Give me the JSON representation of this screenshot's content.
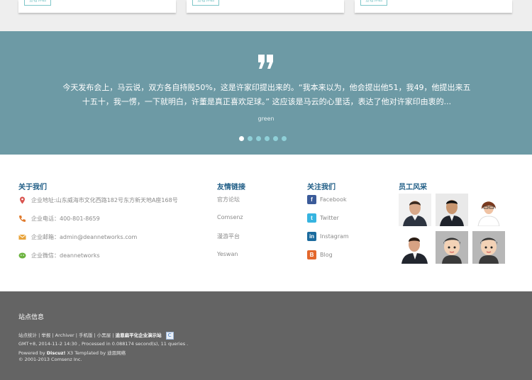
{
  "cards": {
    "more_label": "查看详细"
  },
  "testimonial": {
    "line1": "今天发布会上，马云说，双方各自持股50%，这是许家印提出来的。“我本来以为，他会提出他51，我49，他提出来五",
    "line2": "十五十，我一愣，一下就明白，许董是真正喜欢足球。” 这应该是马云的心里话，表达了他对许家印由衷的...",
    "author": "green",
    "dot_count": 6,
    "active_dot": 0
  },
  "about": {
    "title": "关于我们",
    "address": "企业地址:山东威海市文化西路182号东方新天地A座168号",
    "phone": "企业电话：400-801-8659",
    "email": "企业邮箱：admin@deannetworks.com",
    "wechat": "企业微信：deannetworks"
  },
  "links": {
    "title": "友情链接",
    "items": [
      "官方论坛",
      "Comsenz",
      "漫游平台",
      "Yeswan"
    ]
  },
  "follow": {
    "title": "关注我们",
    "items": [
      {
        "label": "Facebook",
        "icon": "facebook-icon",
        "color": "#3b5b99"
      },
      {
        "label": "Twitter",
        "icon": "twitter-icon",
        "color": "#36b4e0"
      },
      {
        "label": "Instagram",
        "icon": "linkedin-icon",
        "color": "#1b6b9e"
      },
      {
        "label": "Blog",
        "icon": "blogger-icon",
        "color": "#e3672c"
      }
    ]
  },
  "staff": {
    "title": "员工风采"
  },
  "site": {
    "title": "站点信息",
    "nav_line": "站点统计 | 举报 | Archiver | 手机版 | 小黑屋 |",
    "nav_bold": "迪恩扁平化企业演示站",
    "time_line": "GMT+8, 2014-11-2 14:30 , Processed in 0.088174 second(s), 11 queries .",
    "powered_prefix": "Powered by",
    "powered_brand": "Discuz!",
    "powered_suffix": "X3 Templated by 迪恩网络",
    "copyright": "© 2001-2013 Comsenz Inc."
  },
  "colors": {
    "band": "#6d9aa5",
    "footer": "#646464",
    "heading": "#1f5d86",
    "accent": "#7fc7c9"
  }
}
